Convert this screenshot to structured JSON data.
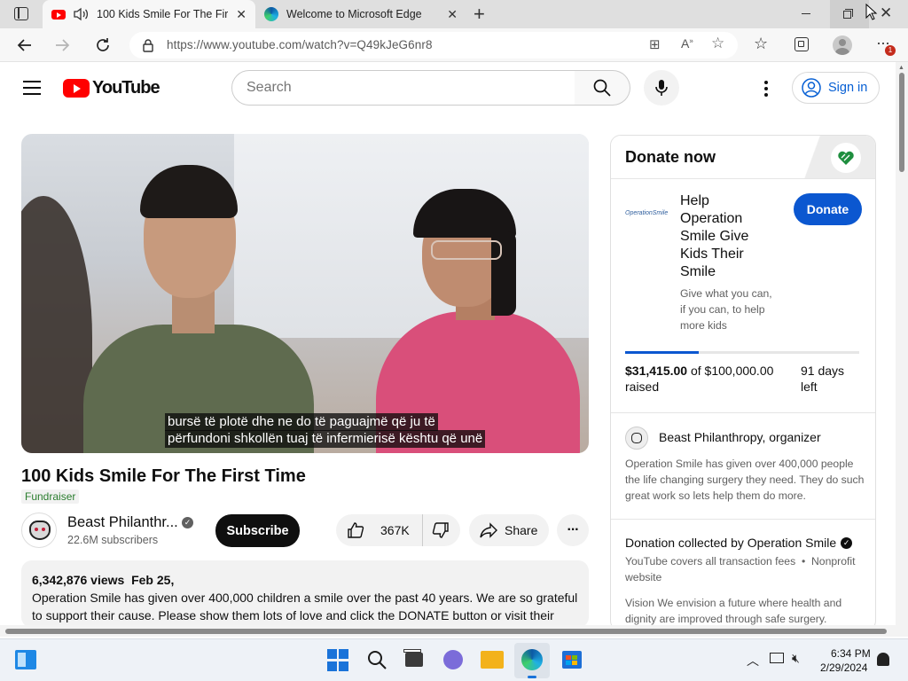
{
  "browser": {
    "tabs": [
      {
        "title": "100 Kids Smile For The First Time",
        "active": true
      },
      {
        "title": "Welcome to Microsoft Edge",
        "active": false
      }
    ],
    "url": "https://www.youtube.com/watch?v=Q49kJeG6nr8",
    "notification_badge": "1"
  },
  "youtube": {
    "logo_text": "YouTube",
    "search_placeholder": "Search",
    "signin_label": "Sign in"
  },
  "video": {
    "captions": [
      "bursë të plotë dhe  ne do të paguajmë që ju të",
      "përfundoni shkollën tuaj të infermierisë kështu që unë"
    ],
    "title": "100 Kids Smile For The First Time",
    "badge": "Fundraiser",
    "channel_name": "Beast Philanthr...",
    "subscribers": "22.6M subscribers",
    "subscribe_label": "Subscribe",
    "likes": "367K",
    "share_label": "Share",
    "views": "6,342,876 views",
    "date": "Feb 25,",
    "description": "Operation Smile has given over 400,000 children a smile over the past 40 years. We are so grateful to support their cause. Please show them lots of love and click the DONATE button or visit their"
  },
  "donate": {
    "header": "Donate now",
    "org_logo_text": "OperationSmile",
    "campaign_title": "Help Operation Smile Give Kids Their Smile",
    "campaign_sub": "Give what you can, if you can, to help more kids",
    "donate_label": "Donate",
    "raised_amount": "$31,415.00",
    "raised_goal": " of $100,000.00",
    "raised_word": "raised",
    "days_left": "91 days left",
    "progress_fraction": 0.314,
    "organizer_name": "Beast Philanthropy",
    "organizer_role": ", organizer",
    "organizer_text": "Operation Smile has given over 400,000 people the life changing surgery they need. They do such great work so lets help them do more.",
    "collected_by": "Donation collected by Operation Smile",
    "fees_text": "YouTube covers all transaction fees",
    "nonprofit": "Nonprofit website",
    "vision_text": "Vision We envision a future where health and dignity are improved through safe surgery."
  },
  "taskbar": {
    "time": "6:34 PM",
    "date": "2/29/2024"
  },
  "colors": {
    "youtube_red": "#ff0000",
    "link_blue": "#065fd4",
    "donate_blue": "#0b57d0",
    "fundraiser_green": "#2a7d2e"
  }
}
